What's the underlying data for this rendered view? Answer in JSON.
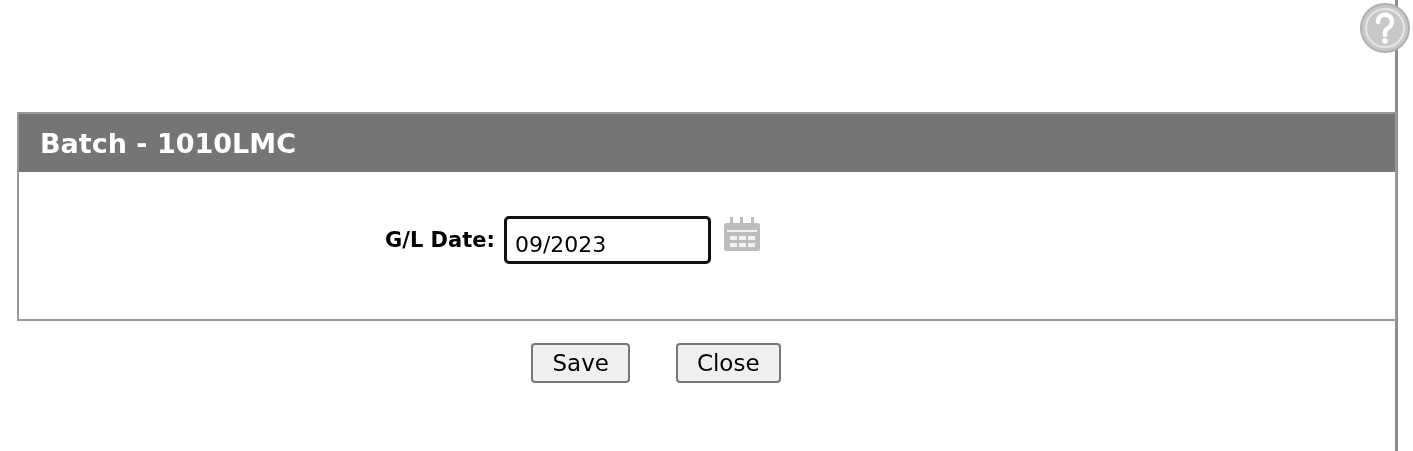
{
  "panel": {
    "title": "Batch - 1010LMC"
  },
  "field": {
    "label": "G/L Date:",
    "value": "09/2023"
  },
  "buttons": [
    "Save",
    "Close"
  ]
}
